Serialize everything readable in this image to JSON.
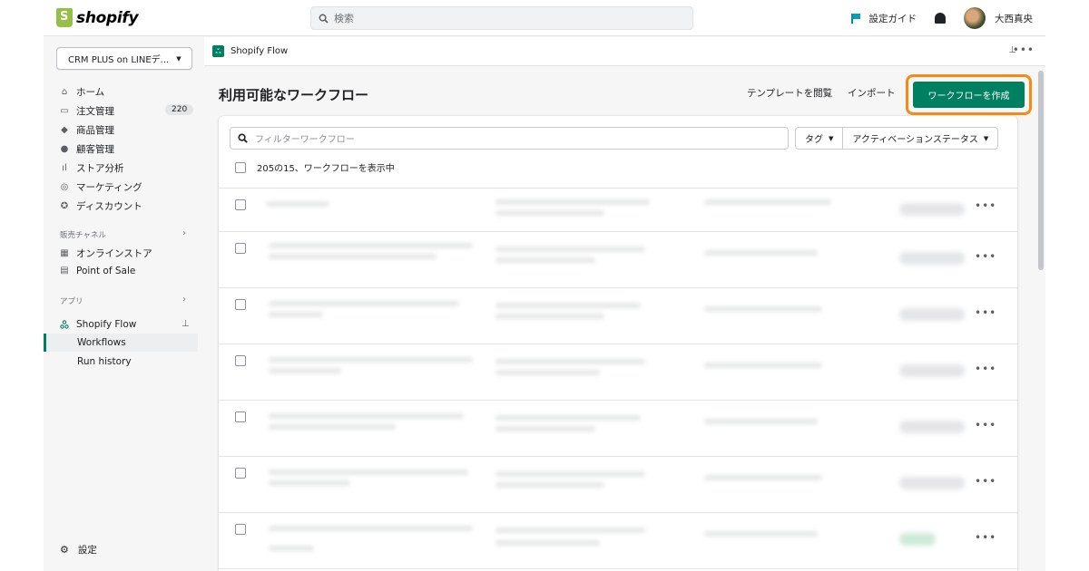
{
  "topbar": {
    "logo_text": "shopify",
    "search_placeholder": "検索",
    "setup_guide": "設定ガイド",
    "user_name": "大西真央"
  },
  "sidebar": {
    "store_name": "CRM PLUS on LINEデ...",
    "items": [
      {
        "label": "ホーム",
        "icon": "home-icon"
      },
      {
        "label": "注文管理",
        "icon": "orders-icon",
        "badge": "220"
      },
      {
        "label": "商品管理",
        "icon": "tag-icon"
      },
      {
        "label": "顧客管理",
        "icon": "customer-icon"
      },
      {
        "label": "ストア分析",
        "icon": "analytics-icon"
      },
      {
        "label": "マーケティング",
        "icon": "marketing-icon"
      },
      {
        "label": "ディスカウント",
        "icon": "discount-icon"
      }
    ],
    "sales_channels_label": "販売チャネル",
    "channels": [
      {
        "label": "オンラインストア",
        "icon": "store-icon"
      },
      {
        "label": "Point of Sale",
        "icon": "pos-icon"
      }
    ],
    "apps_label": "アプリ",
    "app": {
      "label": "Shopify Flow",
      "icon": "flow-icon"
    },
    "sub_items": [
      "Workflows",
      "Run history"
    ],
    "settings_label": "設定"
  },
  "appbar": {
    "title": "Shopify Flow"
  },
  "page": {
    "title": "利用可能なワークフロー",
    "browse_templates": "テンプレートを閲覧",
    "import": "インポート",
    "create_button": "ワークフローを作成",
    "filter_placeholder": "フィルターワークフロー",
    "tag_filter": "タグ",
    "status_filter": "アクティベーションステータス",
    "count_text": "205の15、ワークフローを表示中"
  },
  "colors": {
    "accent_green": "#008060",
    "highlight_orange": "#f48b14"
  }
}
